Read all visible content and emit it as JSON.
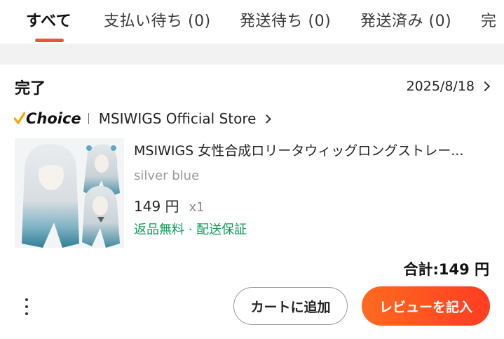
{
  "tabs": [
    {
      "label": "すべて",
      "active": true
    },
    {
      "label": "支払い待ち (0)",
      "active": false
    },
    {
      "label": "発送待ち (0)",
      "active": false
    },
    {
      "label": "発送済み (0)",
      "active": false
    },
    {
      "label": "完",
      "active": false
    }
  ],
  "order": {
    "status": "完了",
    "date": "2025/8/18",
    "store": {
      "badge": "Choice",
      "name": "MSIWIGS Official Store"
    },
    "item": {
      "title": "MSIWIGS 女性合成ロリータウィッグロングストレー...",
      "variant": "silver blue",
      "price": "149 円",
      "quantity": "x1",
      "perks": "返品無料 · 配送保証"
    },
    "total": "合計:149 円"
  },
  "actions": {
    "add_to_cart": "カートに追加",
    "write_review": "レビューを記入"
  },
  "colors": {
    "accent": "#e8543a",
    "review_button": "#ff4f22",
    "perks_text": "#0a9d58"
  },
  "icons": [
    "chevron-right-icon",
    "more-vertical-icon",
    "choice-check-icon"
  ]
}
